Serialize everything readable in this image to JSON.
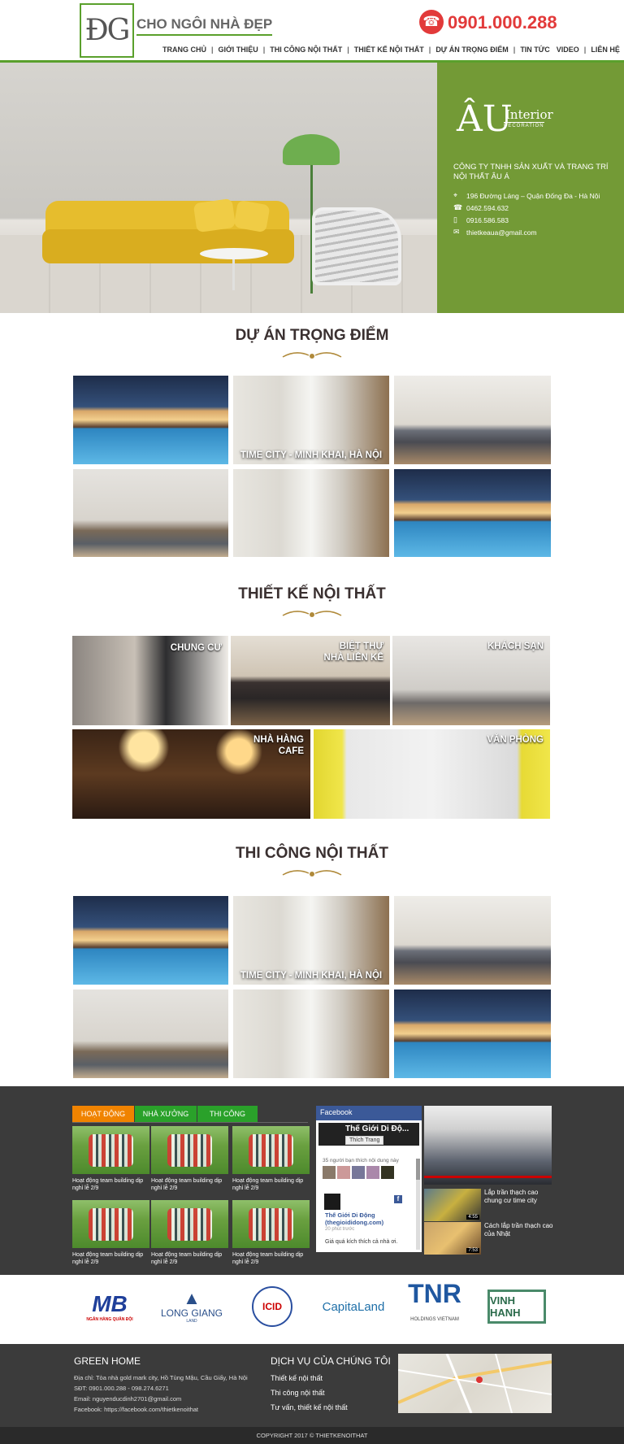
{
  "header": {
    "logo_mark": "ĐG",
    "logo_text": "CHO NGÔI NHÀ ĐẸP",
    "hotline": "0901.000.288",
    "nav": [
      "TRANG CHỦ",
      "GIỚI THIỆU",
      "THI CÔNG NỘI THẤT",
      "THIẾT KẾ NỘI THẤT",
      "DỰ ÁN TRỌNG ĐIỂM",
      "TIN TỨC",
      "VIDEO",
      "LIÊN HỆ"
    ]
  },
  "hero": {
    "brand_symbol": "ÂU",
    "brand_word": "Interior",
    "brand_deco": "DECORATION",
    "company": "CÔNG TY TNHH SẢN XUẤT VÀ TRANG TRÍ NỘI THẤT ÂU Á",
    "address": "196 Đường Láng – Quận Đống Đa - Hà Nội",
    "phone1": "0462.594.632",
    "phone2": "0916.586.583",
    "email": "thietkeaua@gmail.com"
  },
  "projects": {
    "title": "DỰ ÁN TRỌNG ĐIỂM",
    "overlay_caption": "TIME CITY - MINH KHAI, HÀ NỘI"
  },
  "design": {
    "title": "THIẾT KẾ NỘI THẤT",
    "items": [
      "CHUNG CƯ",
      "BIỆT THỰ\nNHÀ LIỀN KỀ",
      "KHÁCH SẠN",
      "NHÀ HÀNG\nCAFE",
      "VĂN PHÒNG"
    ]
  },
  "construction": {
    "title": "THI CÔNG NỘI THẤT",
    "overlay_caption": "TIME CITY - MINH KHAI, HÀ NỘI"
  },
  "activities": {
    "tabs": [
      "HOẠT ĐỘNG",
      "NHÀ XƯỞNG",
      "THI CÔNG"
    ],
    "caption": "Hoạt động team building dịp nghỉ lễ 2/9"
  },
  "facebook": {
    "header": "Facebook",
    "page_name": "Thế Giới Di Độ...",
    "like_label": "Thích Trang",
    "like_count": "35 người bạn thích nội dung này",
    "post_name": "Thế Giới Di Động (thegioididong.com)",
    "post_time": "20 phút trước",
    "post_text": "Giá quá kích thích cả nhà ơi."
  },
  "videos": {
    "items": [
      {
        "title": "Lắp trần thạch cao chung cư time city",
        "duration": "4:55"
      },
      {
        "title": "Cách lắp trần thạch cao của Nhật",
        "duration": "7:53"
      }
    ]
  },
  "partners": [
    "MB",
    "LONG GIANG",
    "ICID",
    "CapitaLand",
    "TNR",
    "VINH HANH"
  ],
  "partner_subs": [
    "NGÂN HÀNG QUÂN ĐỘI",
    "LAND",
    "",
    "",
    "HOLDINGS VIETNAM",
    ""
  ],
  "footer": {
    "title": "GREEN HOME",
    "address": "Địa chỉ: Tòa nhà gold mark city, Hồ Tùng Mậu, Cầu Giấy, Hà Nội",
    "phone": "SĐT: 0901.000.288 - 098.274.6271",
    "email": "Email: nguyenducdinh2701@gmail.com",
    "facebook": "Facebook: https://facebook.com/thietkenoithat",
    "services_title": "DỊCH VỤ CỦA CHÚNG TÔI",
    "services": [
      "Thiết kế nội thất",
      "Thi công nội thất",
      "Tư vấn, thiết kế nội thất"
    ],
    "copyright": "COPYRIGHT 2017 © THIETKENOITHAT"
  },
  "colors": {
    "accent_green": "#5aa02c",
    "hotline_red": "#e23a3a",
    "panel_green": "#739a36",
    "tab_orange": "#f08300",
    "tab_green": "#2aa12a"
  }
}
